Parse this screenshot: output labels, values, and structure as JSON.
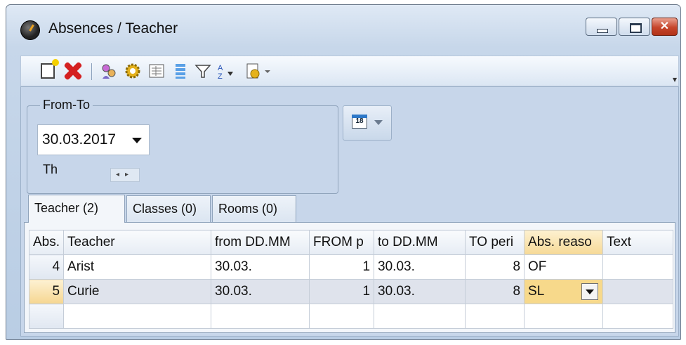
{
  "window": {
    "title": "Absences / Teacher",
    "close_glyph": "✕"
  },
  "toolbar": {
    "icons": [
      "new-icon",
      "delete-icon",
      "teachers-icon",
      "settings-icon",
      "report-icon",
      "list-icon",
      "filter-icon",
      "sort-icon",
      "print-settings-icon"
    ],
    "overflow_glyph": "▾"
  },
  "fromto": {
    "legend": "From-To",
    "date_value": "30.03.2017",
    "day": "Th",
    "calendar_day": "18"
  },
  "tabs": [
    {
      "label": "Teacher (2)"
    },
    {
      "label": "Classes (0)"
    },
    {
      "label": "Rooms (0)"
    }
  ],
  "grid": {
    "columns": [
      "Abs.",
      "Teacher",
      "from DD.MM",
      "FROM p",
      "to DD.MM",
      "TO peri",
      "Abs. reaso",
      "Text"
    ],
    "rows": [
      {
        "abs": "4",
        "teacher": "Arist",
        "from": "30.03.",
        "from_p": "1",
        "to": "30.03.",
        "to_p": "8",
        "reason": "OF",
        "text": ""
      },
      {
        "abs": "5",
        "teacher": "Curie",
        "from": "30.03.",
        "from_p": "1",
        "to": "30.03.",
        "to_p": "8",
        "reason": "SL",
        "text": ""
      }
    ]
  }
}
